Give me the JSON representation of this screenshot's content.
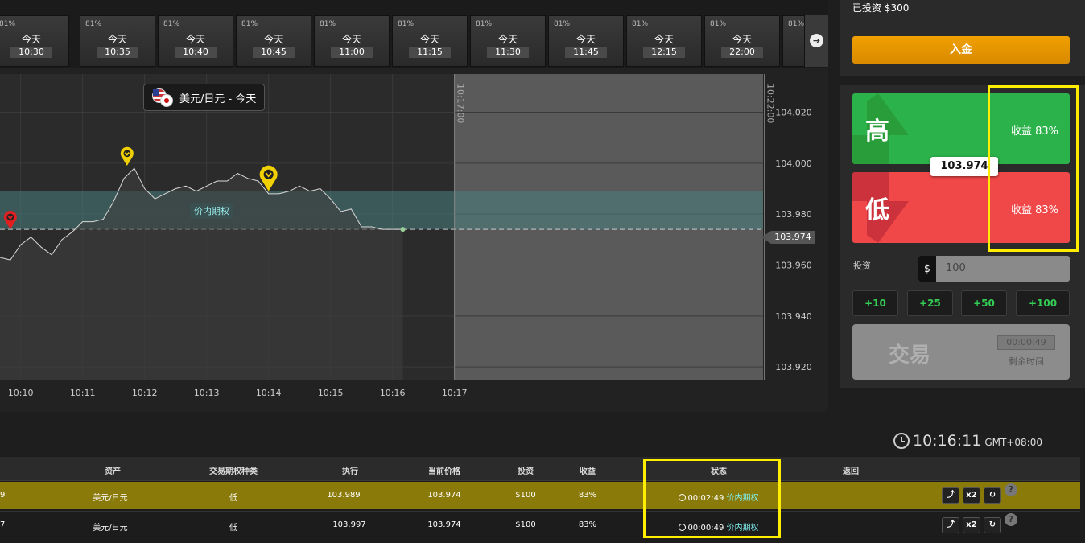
{
  "expiry_tabs": {
    "items": [
      {
        "pct": "81%",
        "day": "今天",
        "time": "10:30"
      },
      {
        "pct": "81%",
        "day": "今天",
        "time": "10:35"
      },
      {
        "pct": "81%",
        "day": "今天",
        "time": "10:40"
      },
      {
        "pct": "81%",
        "day": "今天",
        "time": "10:45"
      },
      {
        "pct": "81%",
        "day": "今天",
        "time": "11:00"
      },
      {
        "pct": "81%",
        "day": "今天",
        "time": "11:15"
      },
      {
        "pct": "81%",
        "day": "今天",
        "time": "11:30"
      },
      {
        "pct": "81%",
        "day": "今天",
        "time": "11:45"
      },
      {
        "pct": "81%",
        "day": "今天",
        "time": "12:15"
      },
      {
        "pct": "81%",
        "day": "今天",
        "time": "22:00"
      },
      {
        "pct": "81%",
        "day": "",
        "time": ""
      }
    ],
    "next_icon": "arrow-right-icon"
  },
  "chart": {
    "asset_label": "美元/日元 - 今天",
    "in_the_money_label": "价内期权",
    "expiry_marker_1": "10:17:00",
    "expiry_marker_2": "10:22:00",
    "current_price_tag": "103.974",
    "x_labels": [
      "10:10",
      "10:11",
      "10:12",
      "10:13",
      "10:14",
      "10:15",
      "10:16",
      "10:17"
    ],
    "y_labels": [
      "104.020",
      "104.000",
      "103.980",
      "103.974",
      "103.960",
      "103.940",
      "103.920"
    ]
  },
  "chart_data": {
    "type": "line",
    "x": [
      "10:09:40",
      "10:09:50",
      "10:10:00",
      "10:10:10",
      "10:10:20",
      "10:10:30",
      "10:10:40",
      "10:10:50",
      "10:11:00",
      "10:11:10",
      "10:11:20",
      "10:11:30",
      "10:11:40",
      "10:11:50",
      "10:12:00",
      "10:12:10",
      "10:12:20",
      "10:12:30",
      "10:12:40",
      "10:12:50",
      "10:13:00",
      "10:13:10",
      "10:13:20",
      "10:13:30",
      "10:13:40",
      "10:13:50",
      "10:14:00",
      "10:14:10",
      "10:14:20",
      "10:14:30",
      "10:14:40",
      "10:14:50",
      "10:15:00",
      "10:15:10",
      "10:15:20",
      "10:15:30",
      "10:15:40",
      "10:15:50",
      "10:16:00",
      "10:16:10"
    ],
    "values": [
      103.963,
      103.962,
      103.968,
      103.971,
      103.967,
      103.964,
      103.97,
      103.973,
      103.977,
      103.977,
      103.978,
      103.985,
      103.994,
      103.998,
      103.99,
      103.986,
      103.988,
      103.99,
      103.991,
      103.989,
      103.991,
      103.993,
      103.993,
      103.996,
      103.994,
      103.993,
      103.988,
      103.988,
      103.989,
      103.991,
      103.989,
      103.99,
      103.986,
      103.981,
      103.982,
      103.975,
      103.975,
      103.974,
      103.974,
      103.974
    ],
    "trade_markers": [
      {
        "time": "10:09:50",
        "price": 103.974,
        "direction": "low",
        "color": "#e02020"
      },
      {
        "time": "10:11:43",
        "price": 103.999,
        "direction": "low",
        "color": "#f0d000"
      },
      {
        "time": "10:14:00",
        "price": 103.989,
        "direction": "low",
        "color": "#f0d000"
      }
    ],
    "in_the_money_band": [
      103.974,
      103.989
    ],
    "expiry_lines": [
      "10:17:00",
      "10:22:00"
    ],
    "ylim": [
      103.915,
      104.035
    ],
    "y_ticks": [
      104.02,
      104.0,
      103.98,
      103.96,
      103.94,
      103.92
    ],
    "grid": true
  },
  "side": {
    "invested_label": "已投资 $300",
    "deposit_label": "入金",
    "high_label": "高",
    "low_label": "低",
    "high_payout": "收益 83%",
    "low_payout": "收益 83%",
    "current_price": "103.974",
    "invest_label": "投资",
    "currency": "$",
    "amount": "100",
    "quick_amounts": [
      "+10",
      "+25",
      "+50",
      "+100"
    ],
    "trade_label": "交易",
    "countdown": "00:00:49",
    "remaining_label": "剩余时间"
  },
  "clock": {
    "time": "10:16:11",
    "tz": "GMT+08:00"
  },
  "colors": {
    "high": "#2cb24a",
    "low": "#f04848",
    "deposit": "#e89400",
    "highlight": "#ffee00",
    "itm": "#7ef0ee"
  },
  "table": {
    "headers": [
      "资产",
      "交易期权种类",
      "执行",
      "当前价格",
      "投资",
      "收益",
      "状态",
      "返回"
    ],
    "rows": [
      {
        "id": "9",
        "asset": "美元/日元",
        "type": "低",
        "strike": "103.989",
        "current": "103.974",
        "invest": "$100",
        "payout": "83%",
        "time": "00:02:49",
        "status": "价内期权",
        "a1": "⤴",
        "a2": "x2",
        "a3": "↻",
        "help": "?"
      },
      {
        "id": "7",
        "asset": "美元/日元",
        "type": "低",
        "strike": "103.997",
        "current": "103.974",
        "invest": "$100",
        "payout": "83%",
        "time": "00:00:49",
        "status": "价内期权",
        "a1": "⤴",
        "a2": "x2",
        "a3": "↻",
        "help": "?"
      }
    ]
  }
}
